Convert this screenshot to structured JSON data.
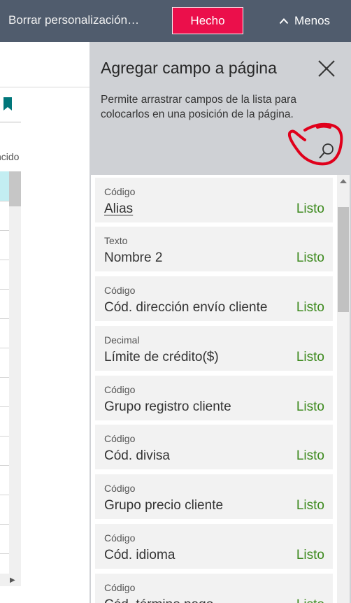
{
  "topbar": {
    "title": "Borrar personalización…",
    "done_label": "Hecho",
    "less_label": "Menos",
    "accent": "#eb0f4b",
    "background": "#505c6d"
  },
  "background_page": {
    "column_text": "ncido",
    "bookmark_icon": "bookmark-icon",
    "accent": "#00767a"
  },
  "pane": {
    "title": "Agregar campo a página",
    "description": "Permite arrastrar campos de la lista para colocarlos en una posición de la página.",
    "close_icon": "close-icon",
    "search_icon": "search-icon"
  },
  "fields": [
    {
      "type": "Código",
      "name": "Alias",
      "status": "Listo"
    },
    {
      "type": "Texto",
      "name": "Nombre 2",
      "status": "Listo"
    },
    {
      "type": "Código",
      "name": "Cód. dirección envío cliente",
      "status": "Listo"
    },
    {
      "type": "Decimal",
      "name": "Límite de crédito($)",
      "status": "Listo"
    },
    {
      "type": "Código",
      "name": "Grupo registro cliente",
      "status": "Listo"
    },
    {
      "type": "Código",
      "name": "Cód. divisa",
      "status": "Listo"
    },
    {
      "type": "Código",
      "name": "Grupo precio cliente",
      "status": "Listo"
    },
    {
      "type": "Código",
      "name": "Cód. idioma",
      "status": "Listo"
    },
    {
      "type": "Código",
      "name": "Cód. término pago",
      "status": "Listo"
    }
  ],
  "colors": {
    "status_green": "#3d8a1e",
    "annotation_red": "#e0001b"
  }
}
